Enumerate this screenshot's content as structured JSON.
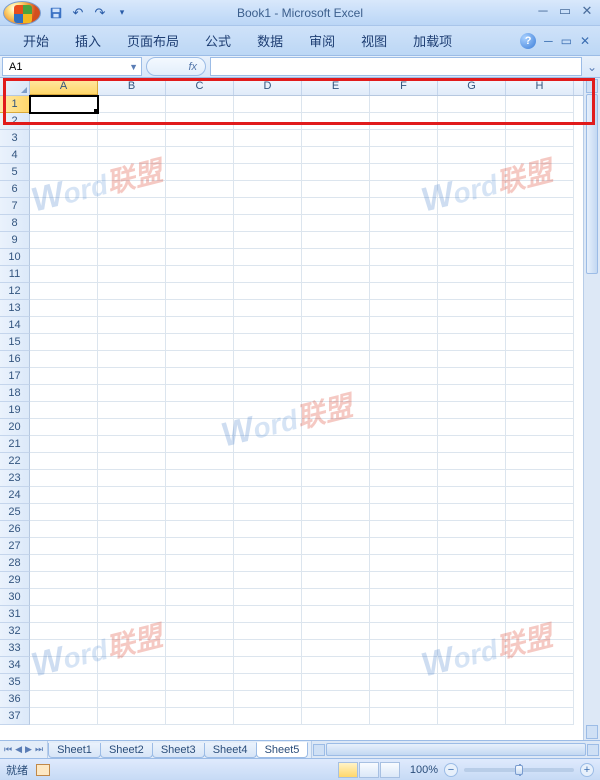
{
  "title": "Book1 - Microsoft Excel",
  "ribbon": {
    "tabs": [
      "开始",
      "插入",
      "页面布局",
      "公式",
      "数据",
      "审阅",
      "视图",
      "加载项"
    ]
  },
  "namebox": "A1",
  "fx_label": "fx",
  "columns": [
    "A",
    "B",
    "C",
    "D",
    "E",
    "F",
    "G",
    "H"
  ],
  "selected_col": "A",
  "selected_row": 1,
  "row_start": 1,
  "row_end": 37,
  "sheets": {
    "tabs": [
      "Sheet1",
      "Sheet2",
      "Sheet3",
      "Sheet4",
      "Sheet5"
    ],
    "active": "Sheet5"
  },
  "status": {
    "ready": "就绪",
    "zoom": "100%"
  },
  "watermark": {
    "w": "W",
    "ord": "ord",
    "lm": "联盟"
  }
}
